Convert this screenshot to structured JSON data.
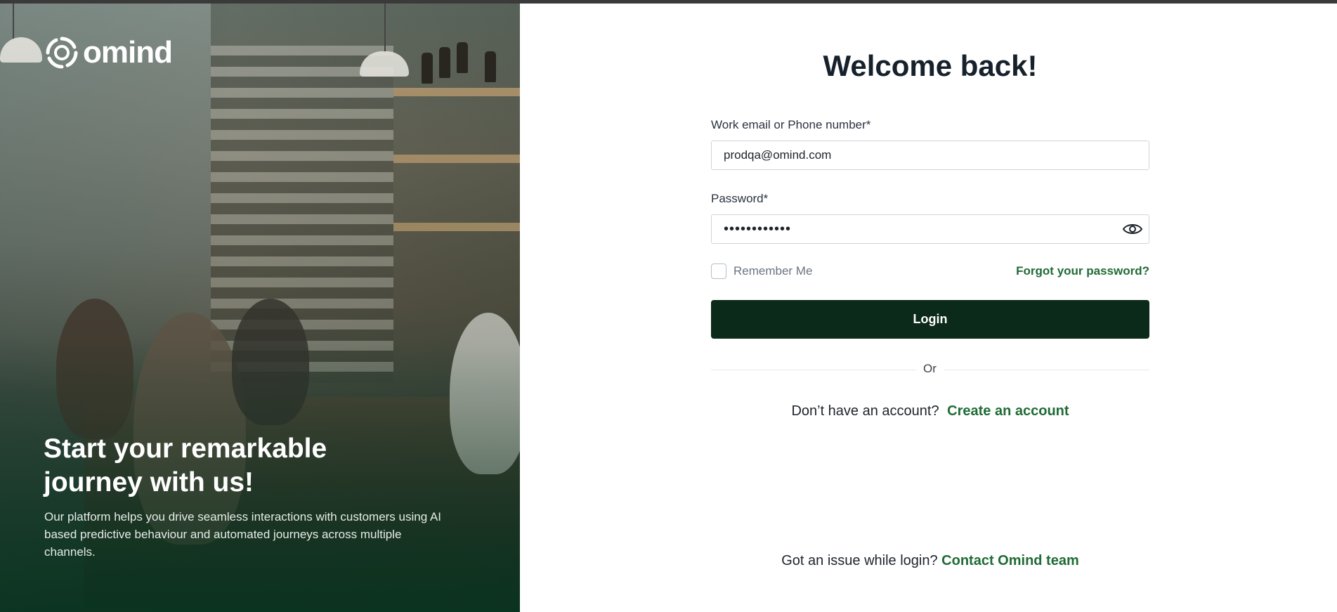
{
  "brand": {
    "name": "omind"
  },
  "hero": {
    "title_line1": "Start your remarkable",
    "title_line2": "journey with us!",
    "description": "Our platform helps you drive seamless interactions with customers using AI based predictive behaviour and automated journeys across multiple channels."
  },
  "form": {
    "heading": "Welcome back!",
    "email_label": "Work email or Phone number*",
    "email_value": "prodqa@omind.com",
    "password_label": "Password*",
    "password_value": "••••••••••••",
    "remember_label": "Remember Me",
    "remember_checked": false,
    "forgot_link": "Forgot your password?",
    "login_button": "Login",
    "or_text": "Or",
    "signup_prompt": "Don’t have an account?",
    "signup_link": "Create an account",
    "issue_prompt": "Got an issue while login?",
    "issue_link": "Contact Omind team"
  },
  "colors": {
    "primary_dark": "#0b2a1a",
    "link_green": "#1f6b35",
    "heading_text": "#17212b"
  },
  "icons": {
    "logo": "omind-swirl-icon",
    "password_toggle": "eye-icon"
  }
}
